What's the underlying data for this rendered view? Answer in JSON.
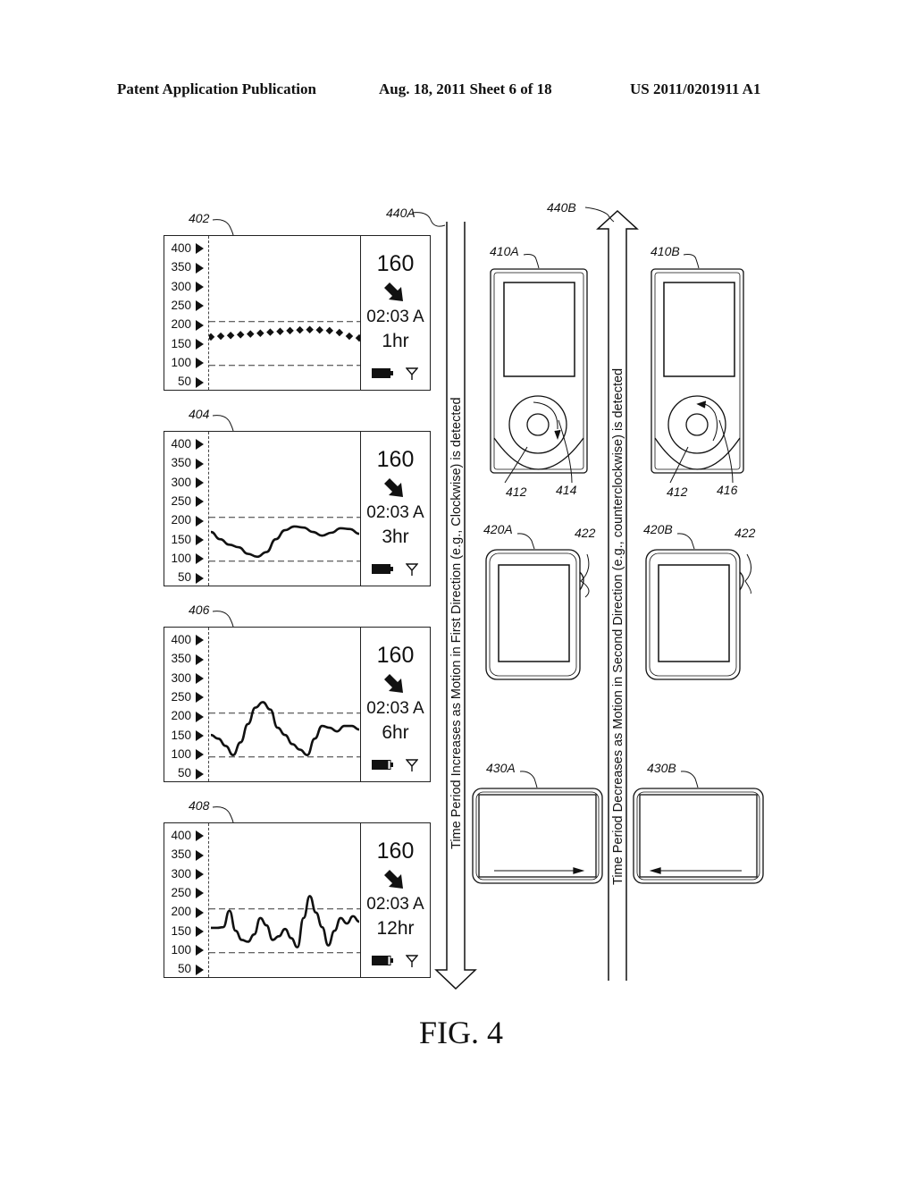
{
  "header": {
    "publication": "Patent Application Publication",
    "date_sheet": "Aug. 18, 2011  Sheet 6 of 18",
    "patent_number": "US 2011/0201911 A1"
  },
  "figure_label": "FIG. 4",
  "y_axis_ticks": [
    "400",
    "350",
    "300",
    "250",
    "200",
    "150",
    "100",
    "50"
  ],
  "panels": [
    {
      "ref": "402",
      "value": "160",
      "trend_icon": "arrow-down-right-icon",
      "time": "02:03 A",
      "duration": "1hr",
      "battery_icon": "battery-full-icon",
      "signal_icon": "antenna-icon",
      "plot_style": "dots",
      "glucose": [
        158,
        160,
        162,
        164,
        166,
        168,
        171,
        173,
        175,
        177,
        178,
        177,
        175,
        170,
        160,
        155
      ]
    },
    {
      "ref": "404",
      "value": "160",
      "trend_icon": "arrow-down-right-icon",
      "time": "02:03 A",
      "duration": "3hr",
      "battery_icon": "battery-full-icon",
      "signal_icon": "antenna-icon",
      "plot_style": "line",
      "glucose": [
        160,
        140,
        125,
        118,
        100,
        92,
        105,
        140,
        165,
        175,
        172,
        160,
        150,
        158,
        170,
        168,
        155
      ]
    },
    {
      "ref": "406",
      "value": "160",
      "trend_icon": "arrow-down-right-icon",
      "time": "02:03 A",
      "duration": "6hr",
      "battery_icon": "battery-high-icon",
      "signal_icon": "antenna-icon",
      "plot_style": "line",
      "glucose": [
        140,
        130,
        110,
        85,
        120,
        170,
        215,
        230,
        210,
        160,
        140,
        115,
        100,
        85,
        130,
        165,
        160,
        150,
        165,
        165,
        155
      ]
    },
    {
      "ref": "408",
      "value": "160",
      "trend_icon": "arrow-down-right-icon",
      "time": "02:03 A",
      "duration": "12hr",
      "battery_icon": "battery-high-icon",
      "signal_icon": "antenna-icon",
      "plot_style": "line",
      "glucose": [
        148,
        148,
        150,
        195,
        140,
        115,
        110,
        130,
        175,
        155,
        115,
        125,
        145,
        120,
        95,
        175,
        235,
        190,
        150,
        100,
        140,
        175,
        160,
        180,
        165
      ]
    }
  ],
  "target_range": {
    "high": 200,
    "low": 80
  },
  "arrows": {
    "increase": {
      "ref": "440A",
      "text": "Time Period Increases as Motion in First Direction (e.g., Clockwise) is detected"
    },
    "decrease": {
      "ref": "440B",
      "text": "Time Period Decreases as Motion in Second Direction (e.g., counterclockwise) is detected"
    }
  },
  "devices": {
    "wheel_a": {
      "ref": "410A",
      "wheel_ref": "412",
      "motion_ref": "414"
    },
    "wheel_b": {
      "ref": "410B",
      "wheel_ref": "412",
      "motion_ref": "416"
    },
    "crown_a": {
      "ref": "420A",
      "crown_ref": "422"
    },
    "crown_b": {
      "ref": "420B",
      "crown_ref": "422"
    },
    "swipe_a": {
      "ref": "430A"
    },
    "swipe_b": {
      "ref": "430B"
    }
  }
}
